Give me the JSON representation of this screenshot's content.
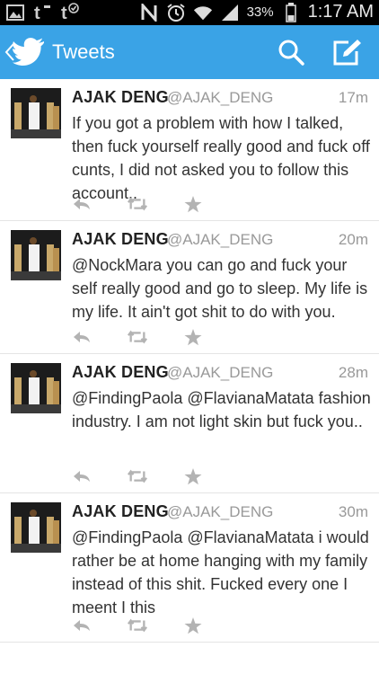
{
  "status_bar": {
    "battery_percent": "33%",
    "time": "1:17 AM"
  },
  "header": {
    "title": "Tweets",
    "accent_color": "#3aa3e6"
  },
  "tweets": [
    {
      "name": "AJAK DENG",
      "handle": "@AJAK_DENG",
      "time": "17m",
      "text": "If you got a problem with how I talked, then fuck yourself really good and fuck off cunts, I did not asked you to follow this account.."
    },
    {
      "name": "AJAK DENG",
      "handle": "@AJAK_DENG",
      "time": "20m",
      "text": "@NockMara you can go and fuck your self really good and go to sleep. My life is my life. It ain't got shit to do with you."
    },
    {
      "name": "AJAK DENG",
      "handle": "@AJAK_DENG",
      "time": "28m",
      "text": "@FindingPaola @FlavianaMatata fashion industry. I am not light skin but fuck you.."
    },
    {
      "name": "AJAK DENG",
      "handle": "@AJAK_DENG",
      "time": "30m",
      "text": "@FindingPaola @FlavianaMatata i would rather  be at home hanging with my family instead of this shit. Fucked every one I meent I this"
    }
  ]
}
